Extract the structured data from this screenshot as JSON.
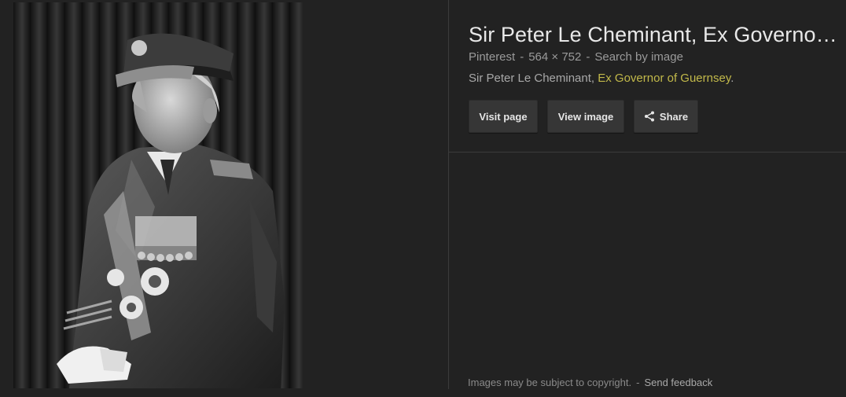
{
  "result": {
    "title": "Sir Peter Le Cheminant, Ex Governo…",
    "source": "Pinterest",
    "dimensions": "564 × 752",
    "search_by_image": "Search by image",
    "separator": "-",
    "description_prefix": "Sir Peter Le Cheminant, ",
    "description_highlight": "Ex Governor of Guernsey",
    "description_suffix": "."
  },
  "buttons": {
    "visit_page": "Visit page",
    "view_image": "View image",
    "share": "Share"
  },
  "footer": {
    "copyright": "Images may be subject to copyright.",
    "separator": "-",
    "send_feedback": "Send feedback"
  },
  "colors": {
    "background": "#222222",
    "highlight": "#c2b94a",
    "divider": "#3b3b3b"
  },
  "icons": {
    "share": "share-icon"
  }
}
